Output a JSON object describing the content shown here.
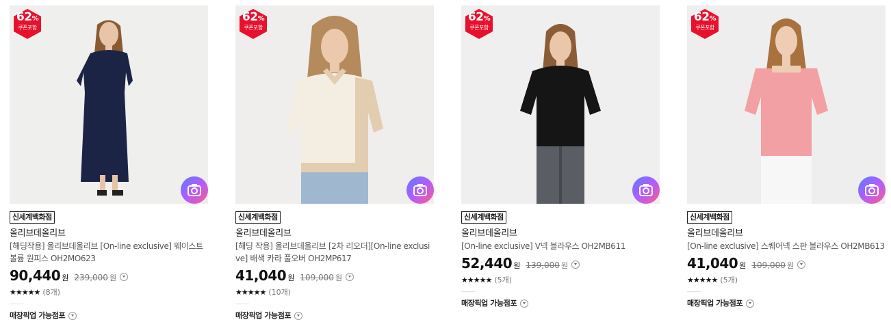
{
  "badge": {
    "percent": "62",
    "percent_sign": "%",
    "sub": "쿠폰포함",
    "color": "#e8112d"
  },
  "products": [
    {
      "store": "신세계백화점",
      "brand": "올리브데올리브",
      "name": "[해딩작용] 올리브데올리브 [On-line exclusive] 웨이스트 볼륨 원피스 OH2MO623",
      "price": "90,440",
      "won": "원",
      "original_price": "239,000",
      "stars": "★★★★★",
      "reviews": "(8개)",
      "pickup": "매장픽업 가능점포",
      "image": "navy-pleated-dress-photo"
    },
    {
      "store": "신세계백화점",
      "brand": "올리브데올리브",
      "name": "[해딩 작용] 올리브데올리브 [2차 리오더][On-line exclusive] 배색 카라 풀오버 OH2MP617",
      "price": "41,040",
      "won": "원",
      "original_price": "109,000",
      "stars": "★★★★★",
      "reviews": "(10개)",
      "pickup": "매장픽업 가능점포",
      "image": "beige-collar-knit-photo"
    },
    {
      "store": "신세계백화점",
      "brand": "올리브데올리브",
      "name": "[On-line exclusive] V넥 블라우스 OH2MB611",
      "price": "52,440",
      "won": "원",
      "original_price": "139,000",
      "stars": "★★★★★",
      "reviews": "(5개)",
      "pickup": "매장픽업 가능점포",
      "image": "black-vneck-blouse-photo"
    },
    {
      "store": "신세계백화점",
      "brand": "올리브데올리브",
      "name": "[On-line exclusive] 스퀘어넥 스판 블라우스 OH2MB613",
      "price": "41,040",
      "won": "원",
      "original_price": "109,000",
      "stars": "★★★★★",
      "reviews": "(5개)",
      "pickup": "매장픽업 가능점포",
      "image": "pink-square-neck-blouse-photo"
    }
  ]
}
